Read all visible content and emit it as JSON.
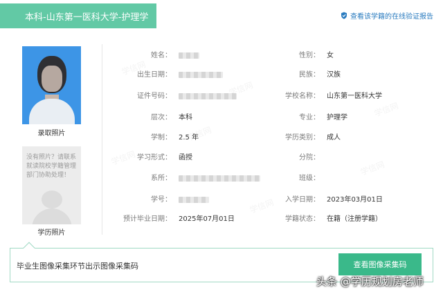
{
  "header": {
    "title": "本科-山东第一医科大学-护理学",
    "verify_link": "查看该学籍的在线验证报告"
  },
  "photos": {
    "admission_label": "录取照片",
    "diploma_label": "学历照片",
    "diploma_placeholder_text": "没有照片？请联系就读院校学籍管理部门协助处理！"
  },
  "fields_left": [
    {
      "label": "姓名：",
      "value": ""
    },
    {
      "label": "出生日期：",
      "value": ""
    },
    {
      "label": "证件号码：",
      "value": ""
    },
    {
      "label": "层次：",
      "value": "本科"
    },
    {
      "label": "学制：",
      "value": "2.5 年"
    },
    {
      "label": "学习形式：",
      "value": "函授"
    },
    {
      "label": "系所：",
      "value": ""
    },
    {
      "label": "学号：",
      "value": ""
    },
    {
      "label": "预计毕业日期：",
      "value": "2025年07月01日"
    }
  ],
  "fields_right": [
    {
      "label": "性别：",
      "value": "女"
    },
    {
      "label": "民族：",
      "value": "汉族"
    },
    {
      "label": "学校名称：",
      "value": "山东第一医科大学"
    },
    {
      "label": "专业：",
      "value": "护理学"
    },
    {
      "label": "学历类别：",
      "value": "成人"
    },
    {
      "label": "分院：",
      "value": ""
    },
    {
      "label": "班级：",
      "value": ""
    },
    {
      "label": "入学日期：",
      "value": "2023年03月01日"
    },
    {
      "label": "学籍状态：",
      "value": "在籍（注册学籍）"
    }
  ],
  "footer": {
    "notice": "毕业生图像采集环节出示图像采集码",
    "button_label": "查看图像采集码"
  },
  "credit": "头条 @学历规划房老师",
  "colors": {
    "accent": "#62c9a5",
    "button": "#3ab98a",
    "link": "#2a7bbf"
  },
  "icons": [
    "shield-check-icon"
  ]
}
